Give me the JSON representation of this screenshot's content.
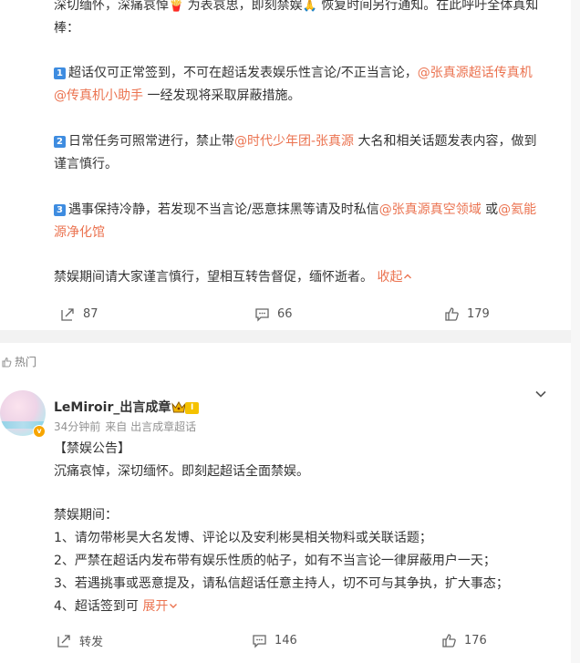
{
  "post1": {
    "lines": [
      {
        "parts": [
          {
            "t": "深切缅怀，深痛哀悼"
          },
          {
            "emoji": "🍟"
          },
          {
            "t": " 为表哀思，即刻禁娱"
          },
          {
            "emoji": "🙏"
          },
          {
            "t": " 恢复时间另行通知。在此呼吁全体真知"
          }
        ]
      },
      {
        "parts": [
          {
            "t": "棒："
          }
        ]
      },
      {
        "parts": [
          {
            "badge": "1"
          },
          {
            "t": "超话仅可正常签到，不可在超话发表娱乐性言论/不正当言论，"
          },
          {
            "m": "@张真源超话传真机"
          }
        ]
      },
      {
        "parts": [
          {
            "m": "@传真机小助手"
          },
          {
            "t": " 一经发现将采取屏蔽措施。"
          }
        ]
      },
      {
        "parts": [
          {
            "badge": "2"
          },
          {
            "t": "日常任务可照常进行，禁止带"
          },
          {
            "m": "@时代少年团-张真源"
          },
          {
            "t": " 大名和相关话题发表内容，做到"
          }
        ]
      },
      {
        "parts": [
          {
            "t": "谨言慎行。"
          }
        ]
      },
      {
        "parts": [
          {
            "badge": "3"
          },
          {
            "t": "遇事保持冷静，若发现不当言论/恶意抹黑等请及时私信"
          },
          {
            "m": "@张真源真空领域"
          },
          {
            "t": " 或"
          },
          {
            "m": "@氦能"
          }
        ]
      },
      {
        "parts": [
          {
            "m": "源净化馆"
          }
        ]
      },
      {
        "parts": [
          {
            "t": "禁娱期间请大家谨言慎行，望相互转告督促，缅怀逝者。 "
          },
          {
            "collapse": "收起"
          }
        ]
      }
    ],
    "actions": {
      "repost": "87",
      "comment": "66",
      "like": "179"
    }
  },
  "post2": {
    "hot_label": "热门",
    "username": "LeMiroir_出言成章",
    "level_badge": "I",
    "time": "34分钟前",
    "source": "来自 出言成章超话",
    "lines": [
      {
        "parts": [
          {
            "t": "【禁娱公告】"
          }
        ]
      },
      {
        "parts": [
          {
            "t": "沉痛哀悼，深切缅怀。即刻起超话全面禁娱。"
          }
        ]
      },
      {
        "parts": [
          {
            "t": "禁娱期间："
          }
        ]
      },
      {
        "parts": [
          {
            "t": "1、请勿带彬昊大名发博、评论以及安利彬昊相关物料或关联话题；"
          }
        ]
      },
      {
        "parts": [
          {
            "t": "2、严禁在超话内发布带有娱乐性质的帖子，如有不当言论一律屏蔽用户一天；"
          }
        ]
      },
      {
        "parts": [
          {
            "t": "3、若遇挑事或恶意提及，请私信超话任意主持人，切不可与其争执，扩大事态；"
          }
        ]
      },
      {
        "parts": [
          {
            "t": "4、超话签到可 "
          },
          {
            "collapse": "展开"
          }
        ]
      }
    ],
    "actions": {
      "repost": "转发",
      "comment": "146",
      "like": "176"
    }
  }
}
